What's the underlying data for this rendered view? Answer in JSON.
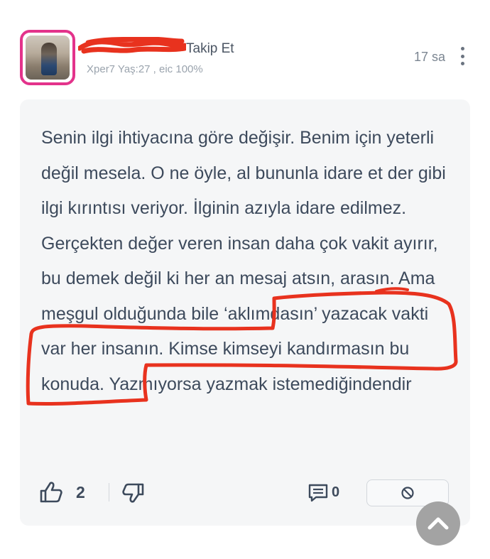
{
  "header": {
    "follow_label": "Takip Et",
    "meta": "Xper7 Yaş:27 , eic 100%",
    "time": "17 sa"
  },
  "comment": {
    "text": "Senin ilgi ihtiyacına göre değişir. Benim için yeterli değil mesela. O ne öyle, al bununla idare et der gibi ilgi kırıntısı veriyor. İlginin azıyla idare edilmez. Gerçekten değer veren insan daha çok vakit ayırır, bu demek değil ki her an mesaj atsın, arasın. Ama meşgul olduğunda bile ‘aklımdasın’ yazacak vakti var her insanın. Kimse kimseyi kandırmasın bu konuda. Yazmıyorsa yazmak istemediğindendir"
  },
  "actions": {
    "like_count": "2",
    "reply_count": "0"
  },
  "colors": {
    "avatar_border": "#e3338b",
    "annotation_red": "#e8321e",
    "text": "#3d4a5c",
    "card_bg": "#f5f6f7"
  },
  "icons": {
    "like": "thumbs-up-icon",
    "dislike": "thumbs-down-icon",
    "reply": "comment-icon",
    "report": "block-icon",
    "more": "more-vertical-icon",
    "scroll_top": "chevron-up-icon"
  }
}
